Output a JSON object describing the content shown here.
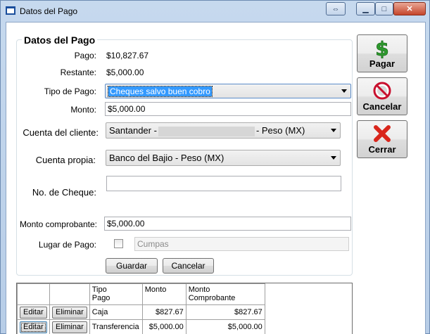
{
  "window": {
    "title": "Datos del Pago"
  },
  "group": {
    "title": "Datos del Pago"
  },
  "form": {
    "pago_label": "Pago:",
    "pago_value": "$10,827.67",
    "restante_label": "Restante:",
    "restante_value": "$5,000.00",
    "tipo_label": "Tipo de Pago:",
    "tipo_value": "Cheques salvo buen cobro",
    "monto_label": "Monto:",
    "monto_value": "$5,000.00",
    "cuenta_cliente_label": "Cuenta del cliente:",
    "cuenta_cliente_prefix": "Santander -",
    "cuenta_cliente_suffix": "- Peso (MX)",
    "cuenta_propia_label": "Cuenta propia:",
    "cuenta_propia_value": "Banco del Bajio - Peso (MX)",
    "cheque_label": "No. de Cheque:",
    "cheque_value": "",
    "monto_comp_label": "Monto comprobante:",
    "monto_comp_value": "$5,000.00",
    "lugar_label": "Lugar de Pago:",
    "lugar_value": "Cumpas",
    "guardar_label": "Guardar",
    "cancelar_label": "Cancelar"
  },
  "side_buttons": {
    "pagar": "Pagar",
    "cancelar": "Cancelar",
    "cerrar": "Cerrar"
  },
  "grid": {
    "headers": [
      "Tipo\nPago",
      "Monto",
      "Monto\nComprobante"
    ],
    "edit_label": "Editar",
    "delete_label": "Eliminar",
    "rows": [
      {
        "tipo": "Caja",
        "monto": "$827.67",
        "comprobante": "$827.67"
      },
      {
        "tipo": "Transferencia",
        "monto": "$5,000.00",
        "comprobante": "$5,000.00"
      }
    ]
  },
  "colors": {
    "pagar_icon": "#2e9a2e",
    "cancelar_icon": "#c8102e",
    "cerrar_icon": "#d9261c"
  }
}
